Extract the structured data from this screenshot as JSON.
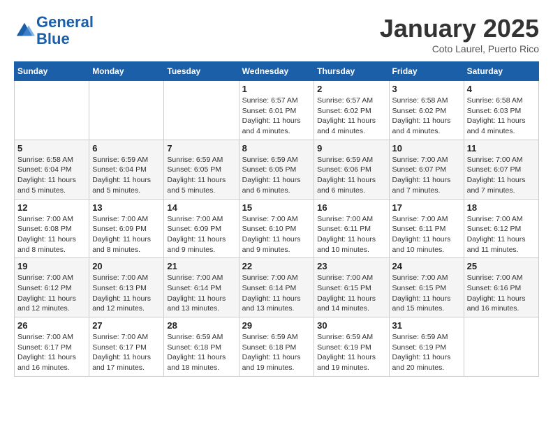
{
  "header": {
    "logo_line1": "General",
    "logo_line2": "Blue",
    "month_title": "January 2025",
    "location": "Coto Laurel, Puerto Rico"
  },
  "weekdays": [
    "Sunday",
    "Monday",
    "Tuesday",
    "Wednesday",
    "Thursday",
    "Friday",
    "Saturday"
  ],
  "weeks": [
    [
      {
        "day": "",
        "info": ""
      },
      {
        "day": "",
        "info": ""
      },
      {
        "day": "",
        "info": ""
      },
      {
        "day": "1",
        "info": "Sunrise: 6:57 AM\nSunset: 6:01 PM\nDaylight: 11 hours and 4 minutes."
      },
      {
        "day": "2",
        "info": "Sunrise: 6:57 AM\nSunset: 6:02 PM\nDaylight: 11 hours and 4 minutes."
      },
      {
        "day": "3",
        "info": "Sunrise: 6:58 AM\nSunset: 6:02 PM\nDaylight: 11 hours and 4 minutes."
      },
      {
        "day": "4",
        "info": "Sunrise: 6:58 AM\nSunset: 6:03 PM\nDaylight: 11 hours and 4 minutes."
      }
    ],
    [
      {
        "day": "5",
        "info": "Sunrise: 6:58 AM\nSunset: 6:04 PM\nDaylight: 11 hours and 5 minutes."
      },
      {
        "day": "6",
        "info": "Sunrise: 6:59 AM\nSunset: 6:04 PM\nDaylight: 11 hours and 5 minutes."
      },
      {
        "day": "7",
        "info": "Sunrise: 6:59 AM\nSunset: 6:05 PM\nDaylight: 11 hours and 5 minutes."
      },
      {
        "day": "8",
        "info": "Sunrise: 6:59 AM\nSunset: 6:05 PM\nDaylight: 11 hours and 6 minutes."
      },
      {
        "day": "9",
        "info": "Sunrise: 6:59 AM\nSunset: 6:06 PM\nDaylight: 11 hours and 6 minutes."
      },
      {
        "day": "10",
        "info": "Sunrise: 7:00 AM\nSunset: 6:07 PM\nDaylight: 11 hours and 7 minutes."
      },
      {
        "day": "11",
        "info": "Sunrise: 7:00 AM\nSunset: 6:07 PM\nDaylight: 11 hours and 7 minutes."
      }
    ],
    [
      {
        "day": "12",
        "info": "Sunrise: 7:00 AM\nSunset: 6:08 PM\nDaylight: 11 hours and 8 minutes."
      },
      {
        "day": "13",
        "info": "Sunrise: 7:00 AM\nSunset: 6:09 PM\nDaylight: 11 hours and 8 minutes."
      },
      {
        "day": "14",
        "info": "Sunrise: 7:00 AM\nSunset: 6:09 PM\nDaylight: 11 hours and 9 minutes."
      },
      {
        "day": "15",
        "info": "Sunrise: 7:00 AM\nSunset: 6:10 PM\nDaylight: 11 hours and 9 minutes."
      },
      {
        "day": "16",
        "info": "Sunrise: 7:00 AM\nSunset: 6:11 PM\nDaylight: 11 hours and 10 minutes."
      },
      {
        "day": "17",
        "info": "Sunrise: 7:00 AM\nSunset: 6:11 PM\nDaylight: 11 hours and 10 minutes."
      },
      {
        "day": "18",
        "info": "Sunrise: 7:00 AM\nSunset: 6:12 PM\nDaylight: 11 hours and 11 minutes."
      }
    ],
    [
      {
        "day": "19",
        "info": "Sunrise: 7:00 AM\nSunset: 6:12 PM\nDaylight: 11 hours and 12 minutes."
      },
      {
        "day": "20",
        "info": "Sunrise: 7:00 AM\nSunset: 6:13 PM\nDaylight: 11 hours and 12 minutes."
      },
      {
        "day": "21",
        "info": "Sunrise: 7:00 AM\nSunset: 6:14 PM\nDaylight: 11 hours and 13 minutes."
      },
      {
        "day": "22",
        "info": "Sunrise: 7:00 AM\nSunset: 6:14 PM\nDaylight: 11 hours and 13 minutes."
      },
      {
        "day": "23",
        "info": "Sunrise: 7:00 AM\nSunset: 6:15 PM\nDaylight: 11 hours and 14 minutes."
      },
      {
        "day": "24",
        "info": "Sunrise: 7:00 AM\nSunset: 6:15 PM\nDaylight: 11 hours and 15 minutes."
      },
      {
        "day": "25",
        "info": "Sunrise: 7:00 AM\nSunset: 6:16 PM\nDaylight: 11 hours and 16 minutes."
      }
    ],
    [
      {
        "day": "26",
        "info": "Sunrise: 7:00 AM\nSunset: 6:17 PM\nDaylight: 11 hours and 16 minutes."
      },
      {
        "day": "27",
        "info": "Sunrise: 7:00 AM\nSunset: 6:17 PM\nDaylight: 11 hours and 17 minutes."
      },
      {
        "day": "28",
        "info": "Sunrise: 6:59 AM\nSunset: 6:18 PM\nDaylight: 11 hours and 18 minutes."
      },
      {
        "day": "29",
        "info": "Sunrise: 6:59 AM\nSunset: 6:18 PM\nDaylight: 11 hours and 19 minutes."
      },
      {
        "day": "30",
        "info": "Sunrise: 6:59 AM\nSunset: 6:19 PM\nDaylight: 11 hours and 19 minutes."
      },
      {
        "day": "31",
        "info": "Sunrise: 6:59 AM\nSunset: 6:19 PM\nDaylight: 11 hours and 20 minutes."
      },
      {
        "day": "",
        "info": ""
      }
    ]
  ]
}
